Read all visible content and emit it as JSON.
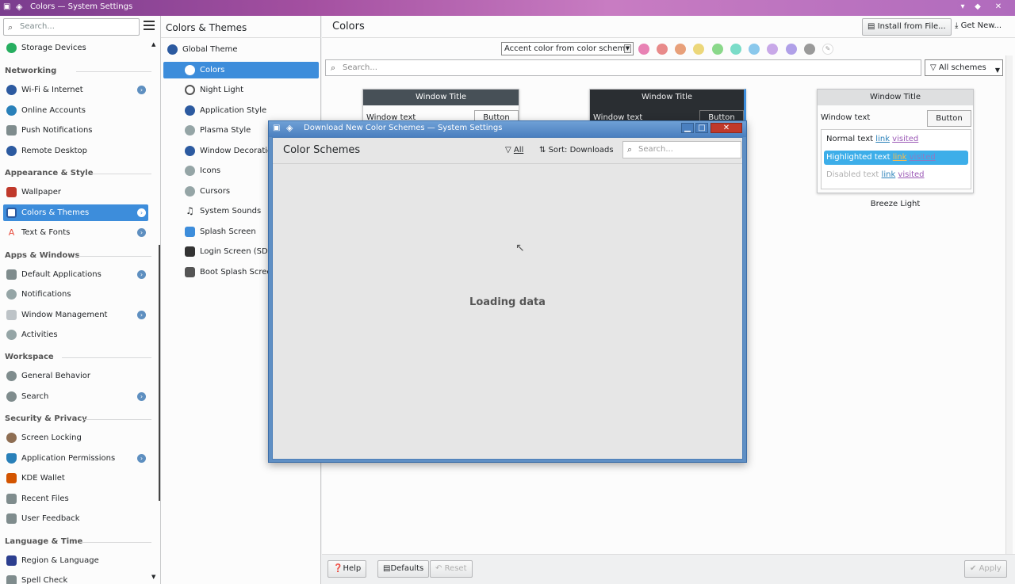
{
  "window": {
    "title": "Colors — System Settings"
  },
  "sidebar": {
    "search_placeholder": "Search...",
    "items": [
      {
        "label": "Storage Devices",
        "color": "#27ae60"
      },
      {
        "label": "Wi-Fi & Internet",
        "color": "#2c5aa0"
      },
      {
        "label": "Online Accounts",
        "color": "#2980b9"
      },
      {
        "label": "Push Notifications",
        "color": "#7f8c8d"
      },
      {
        "label": "Remote Desktop",
        "color": "#2c5aa0"
      },
      {
        "label": "Wallpaper",
        "color": "#c0392b"
      },
      {
        "label": "Colors & Themes",
        "color": "#2c5aa0"
      },
      {
        "label": "Text & Fonts",
        "color": "#e74c3c"
      },
      {
        "label": "Default Applications",
        "color": "#7f8c8d"
      },
      {
        "label": "Notifications",
        "color": "#95a5a6"
      },
      {
        "label": "Window Management",
        "color": "#bdc3c7"
      },
      {
        "label": "Activities",
        "color": "#95a5a6"
      },
      {
        "label": "General Behavior",
        "color": "#7f8c8d"
      },
      {
        "label": "Search",
        "color": "#7f8c8d"
      },
      {
        "label": "Screen Locking",
        "color": "#8e6e53"
      },
      {
        "label": "Application Permissions",
        "color": "#2980b9"
      },
      {
        "label": "KDE Wallet",
        "color": "#d35400"
      },
      {
        "label": "Recent Files",
        "color": "#7f8c8d"
      },
      {
        "label": "User Feedback",
        "color": "#7f8c8d"
      },
      {
        "label": "Region & Language",
        "color": "#2c3e8f"
      },
      {
        "label": "Spell Check",
        "color": "#7f8c8d"
      }
    ],
    "headers": [
      "Networking",
      "Appearance & Style",
      "Apps & Windows",
      "Workspace",
      "Security & Privacy",
      "Language & Time"
    ]
  },
  "subpanel": {
    "title": "Colors & Themes",
    "items": [
      {
        "label": "Global Theme",
        "color": "#2c5aa0"
      },
      {
        "label": "Colors",
        "color": "#ffffff"
      },
      {
        "label": "Night Light",
        "color": "#555555"
      },
      {
        "label": "Application Style",
        "color": "#2c5aa0"
      },
      {
        "label": "Plasma Style",
        "color": "#95a5a6"
      },
      {
        "label": "Window Decorations",
        "color": "#2c5aa0"
      },
      {
        "label": "Icons",
        "color": "#95a5a6"
      },
      {
        "label": "Cursors",
        "color": "#95a5a6"
      },
      {
        "label": "System Sounds",
        "color": "#333333"
      },
      {
        "label": "Splash Screen",
        "color": "#3d8ddb"
      },
      {
        "label": "Login Screen (SDDM)",
        "color": "#333333"
      },
      {
        "label": "Boot Splash Screen",
        "color": "#555555"
      }
    ]
  },
  "main": {
    "title": "Colors",
    "install_label": "Install from File...",
    "get_new_label": "Get New...",
    "accent_combo": "Accent color from color scheme",
    "accent_colors": [
      "#e882b4",
      "#e88a8a",
      "#e8a07a",
      "#ecd77a",
      "#8ad88a",
      "#7adcc8",
      "#8ac8ec",
      "#c8a8e8",
      "#b0a0e8",
      "#9a9a9a"
    ],
    "search_placeholder": "Search...",
    "schemes_filter": "All schemes",
    "preview": {
      "window_title": "Window Title",
      "window_text": "Window text",
      "button": "Button",
      "normal_text": "Normal text",
      "link": "link",
      "visited": "visited",
      "highlighted_text": "Highlighted text",
      "disabled_text": "Disabled text",
      "name": "Breeze Light"
    },
    "help_label": "Help",
    "defaults_label": "Defaults",
    "reset_label": "Reset",
    "apply_label": "Apply"
  },
  "dialog": {
    "title": "Download New Color Schemes — System Settings",
    "heading": "Color Schemes",
    "filter_label": "All",
    "sort_label": "Sort: Downloads",
    "search_placeholder": "Search...",
    "loading": "Loading data"
  }
}
